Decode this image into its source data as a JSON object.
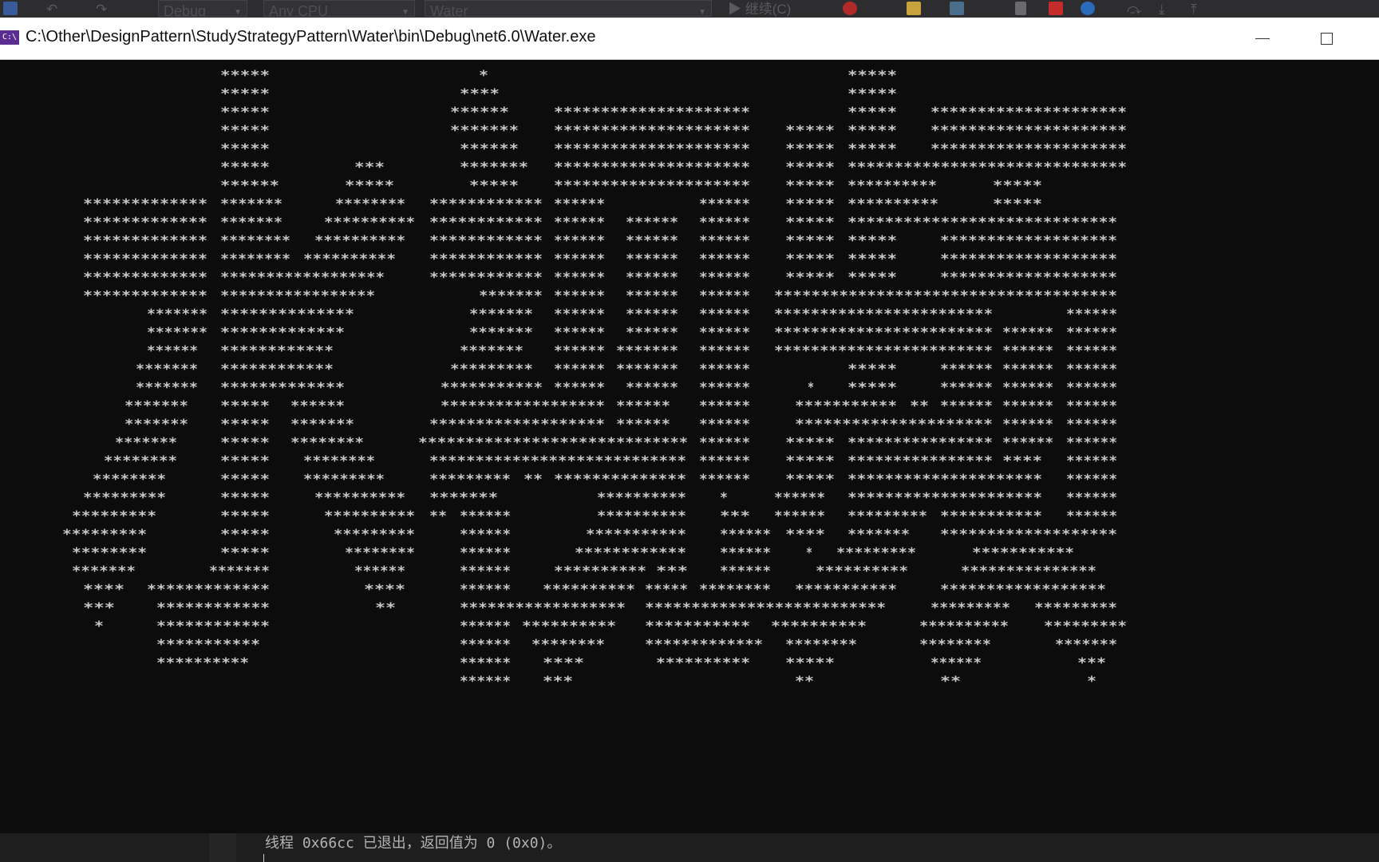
{
  "ide_toolbar": {
    "config_combo": "Debug",
    "platform_combo": "Any CPU",
    "startup_combo": "Water",
    "run_label": "继续(C)",
    "icons": [
      "undo-icon",
      "redo-icon",
      "play-icon",
      "fire-icon",
      "pause-icon",
      "stop-icon",
      "restart-icon",
      "step-over-icon",
      "step-into-icon",
      "step-out-icon"
    ]
  },
  "console": {
    "icon_label": "C:\\",
    "title": "C:\\Other\\DesignPattern\\StudyStrategyPattern\\Water\\bin\\Debug\\net6.0\\Water.exe",
    "window_buttons": [
      "minimize-icon",
      "maximize-icon"
    ],
    "art_glyph": "*",
    "art_color": "#c8c8c8",
    "background": "#0c0c0c"
  },
  "output": {
    "line": "线程 0x66cc 已退出，返回值为 0 (0x0)。"
  }
}
